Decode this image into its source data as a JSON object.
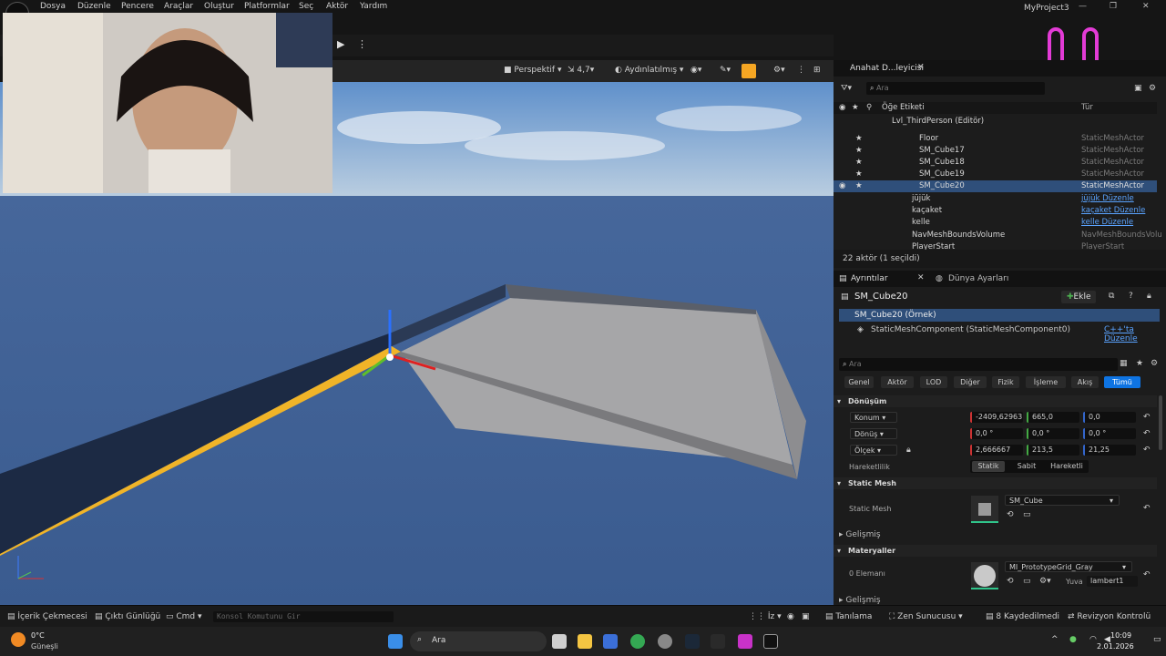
{
  "menubar": {
    "items": [
      "Dosya",
      "Düzenle",
      "Pencere",
      "Araçlar",
      "Oluştur",
      "Platformlar",
      "Seç",
      "Aktör",
      "Yardım"
    ],
    "project": "MyProject3"
  },
  "viewport_toolbar": {
    "perspective": "Perspektif",
    "fov": "4,7",
    "lighting": "Aydınlatılmış"
  },
  "outliner": {
    "tab": "Anahat D...leyicisi",
    "search_placeholder": "Ara",
    "col_label": "Öğe Etiketi",
    "col_type": "Tür",
    "level": "Lvl_ThirdPerson (Editör)",
    "rows": [
      {
        "name": "Floor",
        "type": "StaticMeshActor"
      },
      {
        "name": "SM_Cube17",
        "type": "StaticMeshActor"
      },
      {
        "name": "SM_Cube18",
        "type": "StaticMeshActor"
      },
      {
        "name": "SM_Cube19",
        "type": "StaticMeshActor"
      },
      {
        "name": "SM_Cube20",
        "type": "StaticMeshActor"
      },
      {
        "name": "jüjük",
        "type": "jüjük Düzenle"
      },
      {
        "name": "kaçaket",
        "type": "kaçaket Düzenle"
      },
      {
        "name": "kelle",
        "type": "kelle Düzenle"
      },
      {
        "name": "NavMeshBoundsVolume",
        "type": "NavMeshBoundsVolu"
      },
      {
        "name": "PlayerStart",
        "type": "PlayerStart"
      }
    ],
    "status": "22 aktör (1 seçildi)"
  },
  "details": {
    "tab1": "Ayrıntılar",
    "tab2": "Dünya Ayarları",
    "actor": "SM_Cube20",
    "add": "Ekle",
    "instance": "SM_Cube20 (Örnek)",
    "component": "StaticMeshComponent (StaticMeshComponent0)",
    "cpp_link": "C++'ta Düzenle",
    "search_placeholder": "Ara",
    "filters": [
      "Genel",
      "Aktör",
      "LOD",
      "Diğer",
      "Fizik",
      "İşleme",
      "Akış",
      "Tümü"
    ],
    "transform_header": "Dönüşüm",
    "location_label": "Konum",
    "location": [
      "-2409,62963",
      "665,0",
      "0,0"
    ],
    "rotation_label": "Dönüş",
    "rotation": [
      "0,0 °",
      "0,0 °",
      "0,0 °"
    ],
    "scale_label": "Ölçek",
    "scale": [
      "2,666667",
      "213,5",
      "21,25"
    ],
    "mobility_label": "Hareketlilik",
    "mobility": [
      "Statik",
      "Sabit",
      "Hareketli"
    ],
    "static_mesh_header": "Static Mesh",
    "static_mesh_label": "Static Mesh",
    "static_mesh_value": "SM_Cube",
    "advanced": "Gelişmiş",
    "materials_header": "Materyaller",
    "element_label": "0 Elemanı",
    "material_value": "MI_PrototypeGrid_Gray",
    "slot_label": "Yuva",
    "slot_value": "lambert1",
    "advanced2": "Gelişmiş"
  },
  "bottombar": {
    "content": "İçerik Çekmecesi",
    "output": "Çıktı Günlüğü",
    "cmd": "Cmd",
    "console_placeholder": "Konsol Komutunu Gir",
    "iz": "İz",
    "derive": "Tanılama",
    "zen": "Zen Sunucusu",
    "saved": "8 Kaydedilmedi",
    "revision": "Revizyon Kontrolü"
  },
  "taskbar": {
    "temp": "0°C",
    "weather": "Güneşli",
    "search": "Ara",
    "time": "10:09",
    "date": "2.01.2026"
  },
  "colors": {
    "accent": "#0e74e3",
    "selected": "#2f4f7a",
    "link": "#5aa3ff",
    "highlight": "#f5a623"
  }
}
